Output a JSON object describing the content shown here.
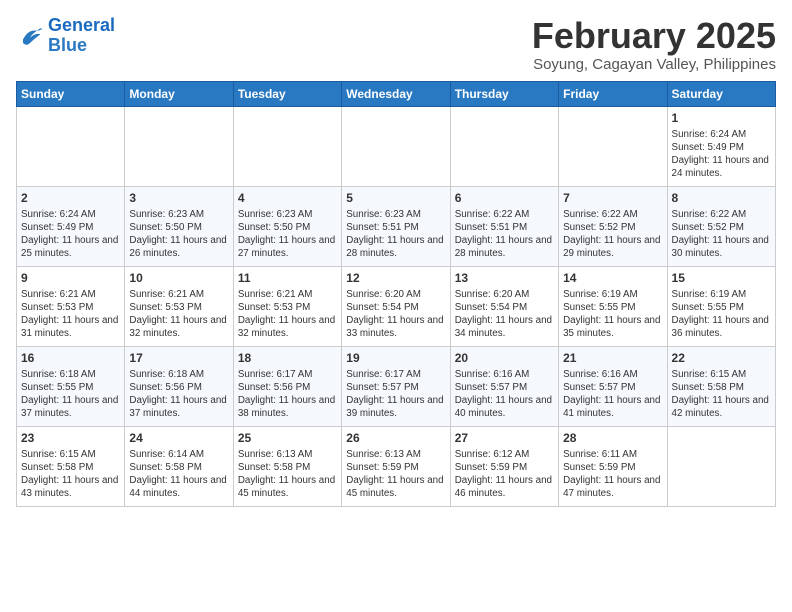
{
  "header": {
    "logo_line1": "General",
    "logo_line2": "Blue",
    "month": "February 2025",
    "location": "Soyung, Cagayan Valley, Philippines"
  },
  "days_of_week": [
    "Sunday",
    "Monday",
    "Tuesday",
    "Wednesday",
    "Thursday",
    "Friday",
    "Saturday"
  ],
  "weeks": [
    [
      {
        "day": "",
        "info": ""
      },
      {
        "day": "",
        "info": ""
      },
      {
        "day": "",
        "info": ""
      },
      {
        "day": "",
        "info": ""
      },
      {
        "day": "",
        "info": ""
      },
      {
        "day": "",
        "info": ""
      },
      {
        "day": "1",
        "info": "Sunrise: 6:24 AM\nSunset: 5:49 PM\nDaylight: 11 hours and 24 minutes."
      }
    ],
    [
      {
        "day": "2",
        "info": "Sunrise: 6:24 AM\nSunset: 5:49 PM\nDaylight: 11 hours and 25 minutes."
      },
      {
        "day": "3",
        "info": "Sunrise: 6:23 AM\nSunset: 5:50 PM\nDaylight: 11 hours and 26 minutes."
      },
      {
        "day": "4",
        "info": "Sunrise: 6:23 AM\nSunset: 5:50 PM\nDaylight: 11 hours and 27 minutes."
      },
      {
        "day": "5",
        "info": "Sunrise: 6:23 AM\nSunset: 5:51 PM\nDaylight: 11 hours and 28 minutes."
      },
      {
        "day": "6",
        "info": "Sunrise: 6:22 AM\nSunset: 5:51 PM\nDaylight: 11 hours and 28 minutes."
      },
      {
        "day": "7",
        "info": "Sunrise: 6:22 AM\nSunset: 5:52 PM\nDaylight: 11 hours and 29 minutes."
      },
      {
        "day": "8",
        "info": "Sunrise: 6:22 AM\nSunset: 5:52 PM\nDaylight: 11 hours and 30 minutes."
      }
    ],
    [
      {
        "day": "9",
        "info": "Sunrise: 6:21 AM\nSunset: 5:53 PM\nDaylight: 11 hours and 31 minutes."
      },
      {
        "day": "10",
        "info": "Sunrise: 6:21 AM\nSunset: 5:53 PM\nDaylight: 11 hours and 32 minutes."
      },
      {
        "day": "11",
        "info": "Sunrise: 6:21 AM\nSunset: 5:53 PM\nDaylight: 11 hours and 32 minutes."
      },
      {
        "day": "12",
        "info": "Sunrise: 6:20 AM\nSunset: 5:54 PM\nDaylight: 11 hours and 33 minutes."
      },
      {
        "day": "13",
        "info": "Sunrise: 6:20 AM\nSunset: 5:54 PM\nDaylight: 11 hours and 34 minutes."
      },
      {
        "day": "14",
        "info": "Sunrise: 6:19 AM\nSunset: 5:55 PM\nDaylight: 11 hours and 35 minutes."
      },
      {
        "day": "15",
        "info": "Sunrise: 6:19 AM\nSunset: 5:55 PM\nDaylight: 11 hours and 36 minutes."
      }
    ],
    [
      {
        "day": "16",
        "info": "Sunrise: 6:18 AM\nSunset: 5:55 PM\nDaylight: 11 hours and 37 minutes."
      },
      {
        "day": "17",
        "info": "Sunrise: 6:18 AM\nSunset: 5:56 PM\nDaylight: 11 hours and 37 minutes."
      },
      {
        "day": "18",
        "info": "Sunrise: 6:17 AM\nSunset: 5:56 PM\nDaylight: 11 hours and 38 minutes."
      },
      {
        "day": "19",
        "info": "Sunrise: 6:17 AM\nSunset: 5:57 PM\nDaylight: 11 hours and 39 minutes."
      },
      {
        "day": "20",
        "info": "Sunrise: 6:16 AM\nSunset: 5:57 PM\nDaylight: 11 hours and 40 minutes."
      },
      {
        "day": "21",
        "info": "Sunrise: 6:16 AM\nSunset: 5:57 PM\nDaylight: 11 hours and 41 minutes."
      },
      {
        "day": "22",
        "info": "Sunrise: 6:15 AM\nSunset: 5:58 PM\nDaylight: 11 hours and 42 minutes."
      }
    ],
    [
      {
        "day": "23",
        "info": "Sunrise: 6:15 AM\nSunset: 5:58 PM\nDaylight: 11 hours and 43 minutes."
      },
      {
        "day": "24",
        "info": "Sunrise: 6:14 AM\nSunset: 5:58 PM\nDaylight: 11 hours and 44 minutes."
      },
      {
        "day": "25",
        "info": "Sunrise: 6:13 AM\nSunset: 5:58 PM\nDaylight: 11 hours and 45 minutes."
      },
      {
        "day": "26",
        "info": "Sunrise: 6:13 AM\nSunset: 5:59 PM\nDaylight: 11 hours and 45 minutes."
      },
      {
        "day": "27",
        "info": "Sunrise: 6:12 AM\nSunset: 5:59 PM\nDaylight: 11 hours and 46 minutes."
      },
      {
        "day": "28",
        "info": "Sunrise: 6:11 AM\nSunset: 5:59 PM\nDaylight: 11 hours and 47 minutes."
      },
      {
        "day": "",
        "info": ""
      }
    ]
  ]
}
